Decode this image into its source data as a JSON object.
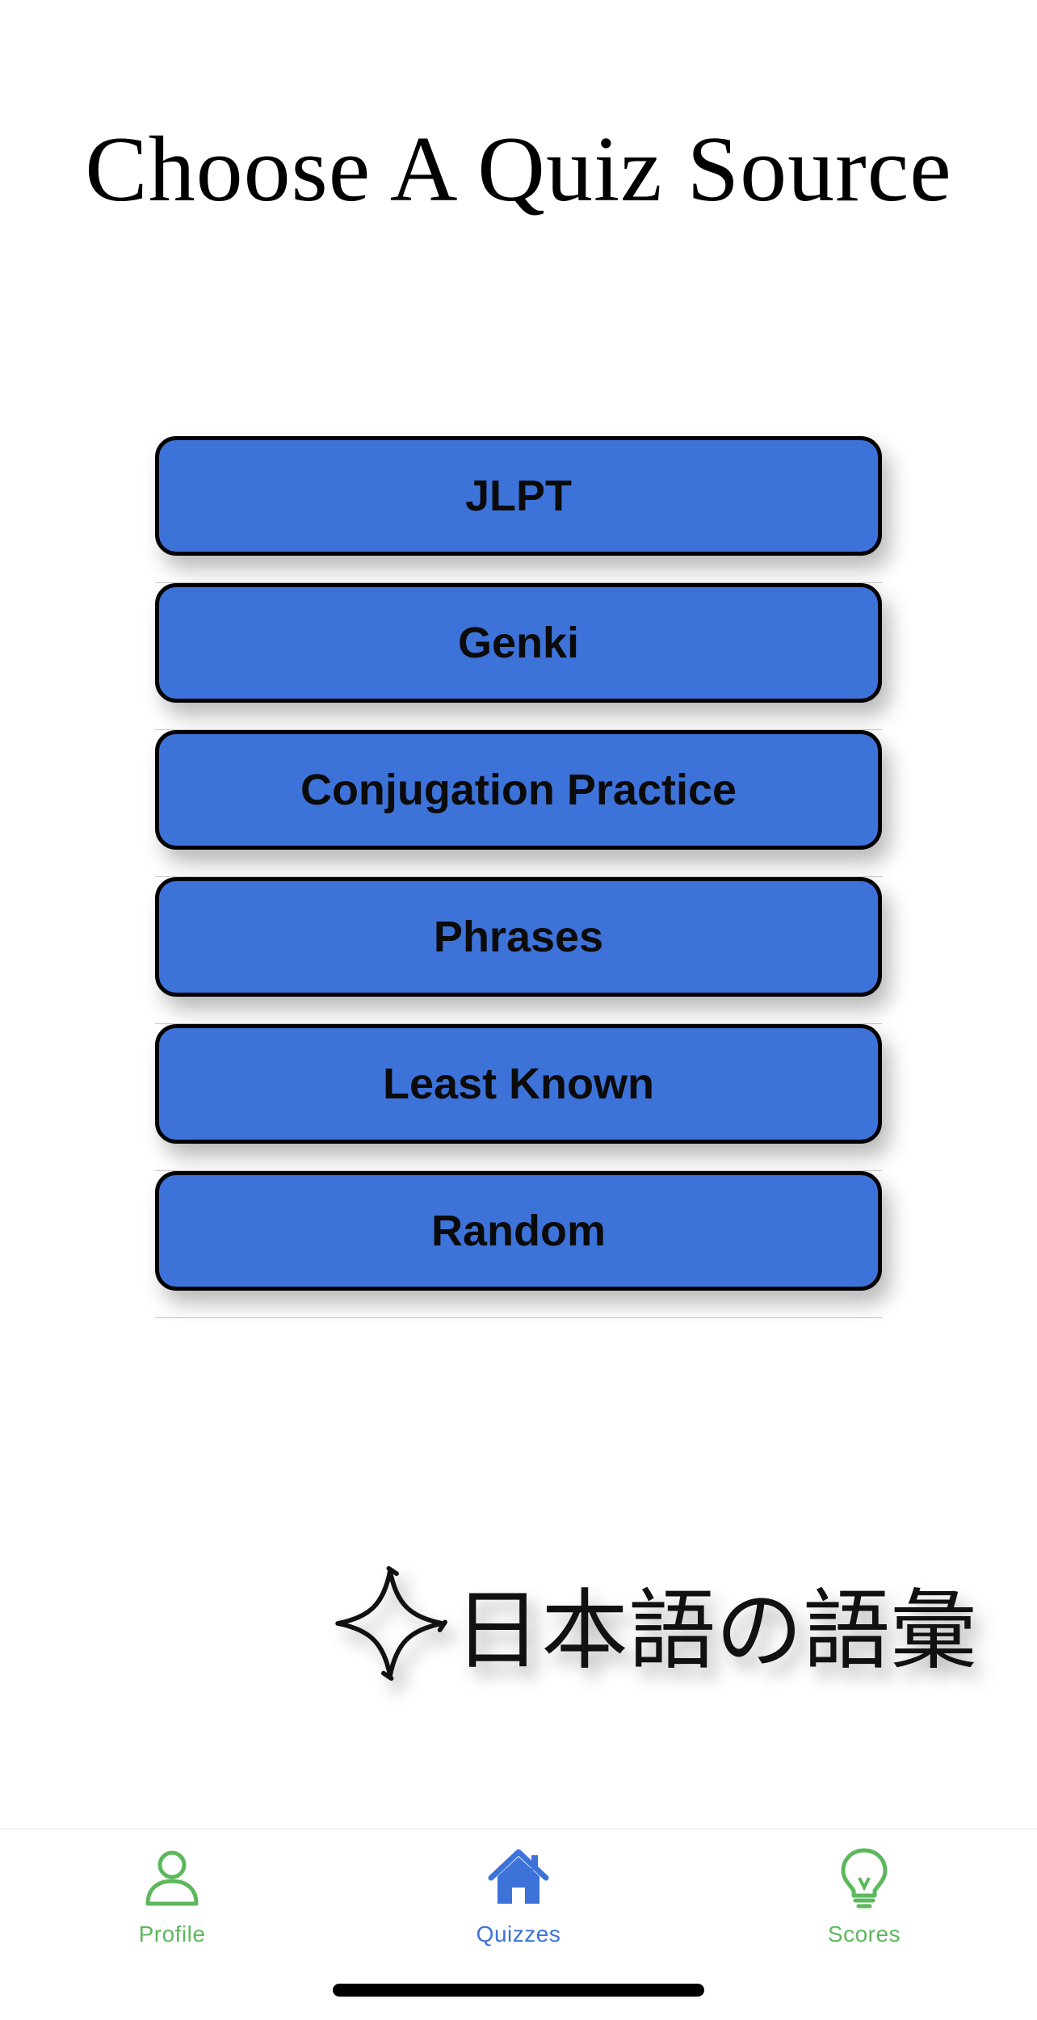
{
  "page": {
    "title": "Choose A Quiz Source"
  },
  "sources": [
    {
      "label": "JLPT"
    },
    {
      "label": "Genki"
    },
    {
      "label": "Conjugation Practice"
    },
    {
      "label": "Phrases"
    },
    {
      "label": "Least Known"
    },
    {
      "label": "Random"
    }
  ],
  "logo": {
    "text": "日本語の語彙",
    "icon": "sparkle-icon"
  },
  "tabbar": {
    "tabs": [
      {
        "label": "Profile",
        "icon": "person-icon",
        "color": "#5cb85c",
        "selected": false
      },
      {
        "label": "Quizzes",
        "icon": "home-icon",
        "color": "#3d73d9",
        "selected": true
      },
      {
        "label": "Scores",
        "icon": "lightbulb-icon",
        "color": "#5cb85c",
        "selected": false
      }
    ]
  },
  "colors": {
    "button_fill": "#3d73d9",
    "tab_inactive": "#5cb85c",
    "tab_active": "#3d73d9"
  }
}
